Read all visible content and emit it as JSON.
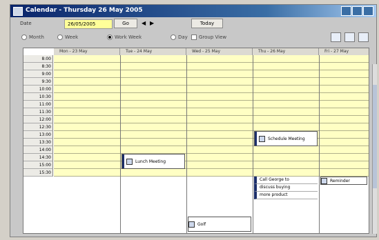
{
  "window": {
    "title": "Calendar - Thursday 26 May 2005"
  },
  "toolbar": {
    "date_label": "Date",
    "date_value": "26/05/2005",
    "go_label": "Go",
    "today_label": "Today"
  },
  "views": {
    "month": "Month",
    "week": "Week",
    "work_week": "Work Week",
    "day": "Day",
    "group_view": "Group View"
  },
  "days": [
    "Mon - 23 May",
    "Tue - 24 May",
    "Wed - 25 May",
    "Thu - 26 May",
    "Fri - 27 May"
  ],
  "times": [
    "8:00",
    "8:30",
    "9:00",
    "9:30",
    "10:00",
    "10:30",
    "11:00",
    "11:30",
    "12:00",
    "12:30",
    "13:00",
    "13:30",
    "14:00",
    "14:30",
    "15:00",
    "15:30"
  ],
  "appointments": {
    "lunch": "Lunch Meeting",
    "schedule": "Schedule Meeting",
    "call_line1": "Call George to",
    "call_line2": "discuss buying",
    "call_line3": "more product",
    "reminder": "Reminder",
    "golf": "Golf"
  },
  "colors": {
    "grid": "#ffffc4",
    "title_start": "#0a246a",
    "title_end": "#a6caf0"
  }
}
